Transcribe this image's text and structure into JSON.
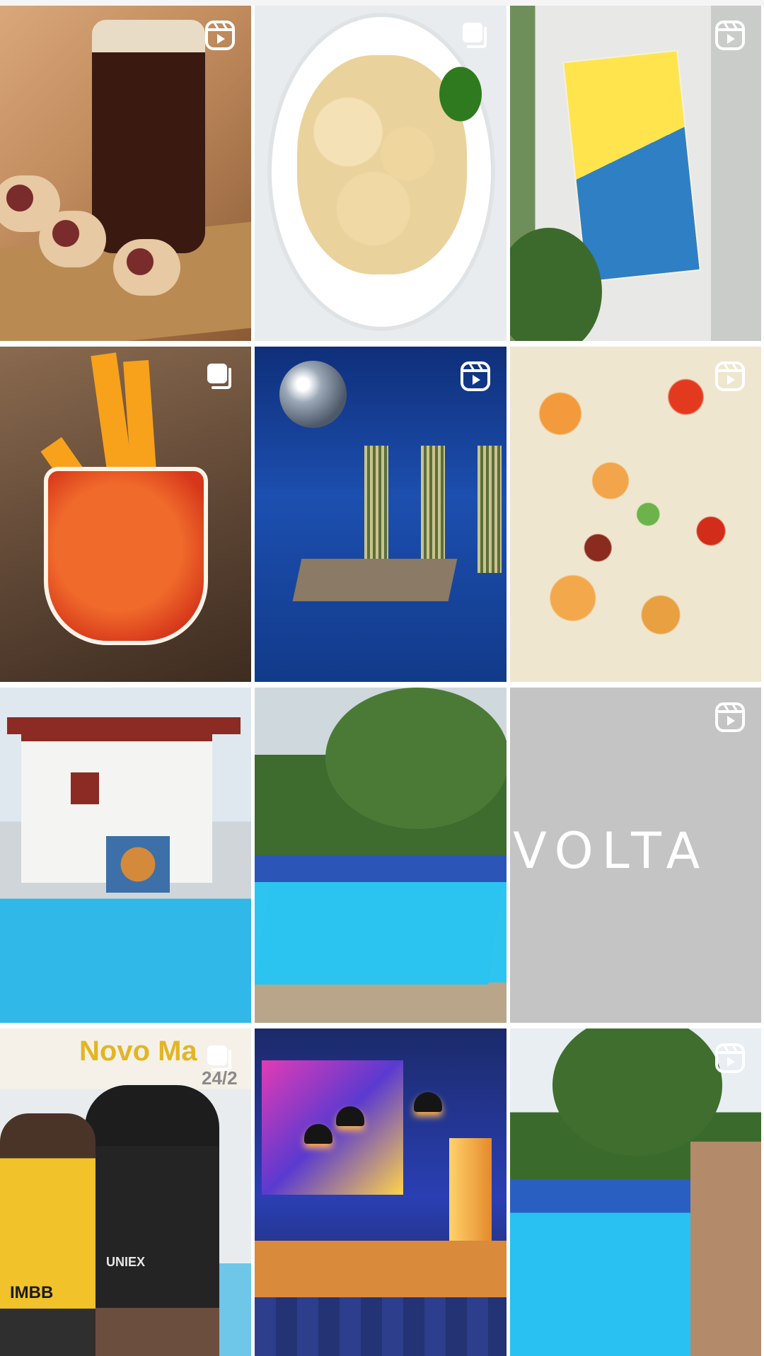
{
  "feed": {
    "tiles": [
      {
        "name": "post-iced-coffee-and-rolls",
        "badge": "reel-icon"
      },
      {
        "name": "post-gnocchi-dish",
        "badge": "carousel-icon"
      },
      {
        "name": "post-poster-on-wall",
        "badge": "reel-icon"
      },
      {
        "name": "post-orange-drink",
        "badge": "carousel-icon"
      },
      {
        "name": "post-disco-room",
        "badge": "reel-icon"
      },
      {
        "name": "post-rice-dish",
        "badge": "reel-icon"
      },
      {
        "name": "post-house-with-pool",
        "badge": "none"
      },
      {
        "name": "post-garden-pool",
        "badge": "none"
      },
      {
        "name": "post-volta-logo",
        "badge": "reel-icon",
        "text": "VOLTA"
      },
      {
        "name": "post-event-flyer",
        "badge": "carousel-icon",
        "title": "Novo Ma",
        "date": "24/2",
        "shirt_left": "IMBB",
        "shirt_right": "UNIEX"
      },
      {
        "name": "post-neon-bar",
        "badge": "none"
      },
      {
        "name": "post-pool-wide",
        "badge": "reel-icon"
      }
    ]
  },
  "colors": {
    "badge_fill": "#ffffff",
    "background": "#ffffff"
  }
}
